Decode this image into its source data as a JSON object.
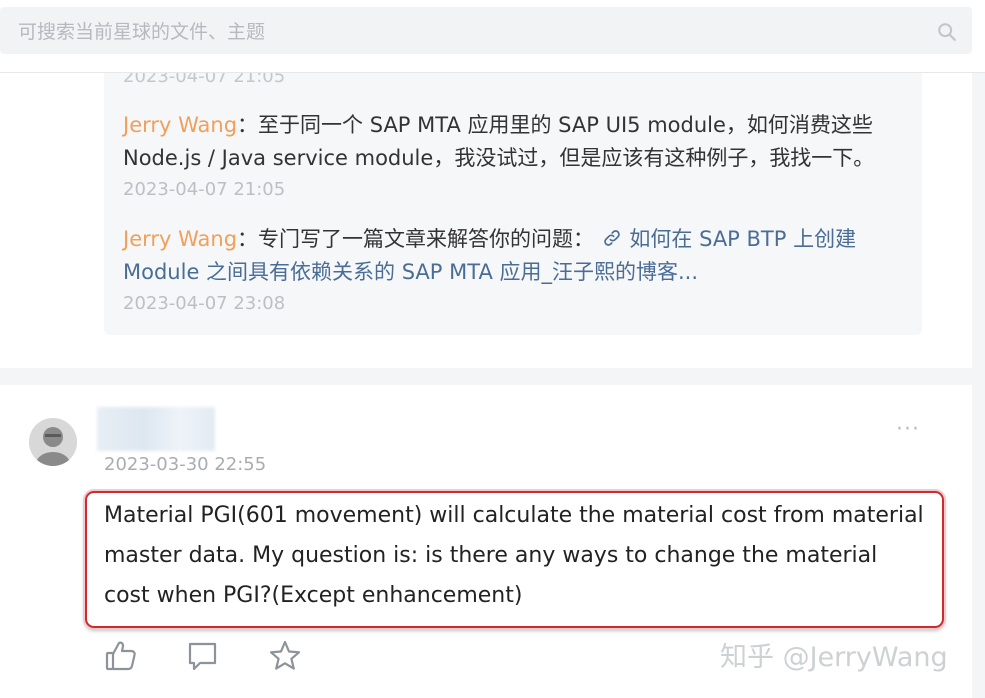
{
  "search": {
    "placeholder": "可搜索当前星球的文件、主题",
    "icon": "search-icon"
  },
  "thread": {
    "cut_timestamp": "2023-04-07 21:05",
    "replies": [
      {
        "author": "Jerry Wang",
        "separator": "：",
        "text": "至于同一个 SAP MTA 应用里的 SAP UI5 module，如何消费这些 Node.js / Java service module，我没试过，但是应该有这种例子，我找一下。",
        "time": "2023-04-07 21:05"
      },
      {
        "author": "Jerry Wang",
        "separator": "：",
        "text": "专门写了一篇文章来解答你的问题：",
        "link_icon": "link-icon",
        "link_text": "如何在 SAP BTP 上创建 Module 之间具有依赖关系的 SAP MTA 应用_汪子熙的博客...",
        "time": "2023-04-07 23:08"
      }
    ]
  },
  "post": {
    "avatar_icon": "avatar",
    "time": "2023-03-30 22:55",
    "more_label": "···",
    "question": "Material PGI(601 movement) will calculate the material cost from material master data. My question is: is there any ways to change the material cost when PGI?(Except enhancement)",
    "actions": [
      {
        "name": "like-icon"
      },
      {
        "name": "comment-icon"
      },
      {
        "name": "star-icon"
      }
    ]
  },
  "watermark": "知乎 @JerryWang",
  "colors": {
    "author": "#f0a05a",
    "link": "#4a6d96",
    "highlight_border": "#cf2a32"
  }
}
